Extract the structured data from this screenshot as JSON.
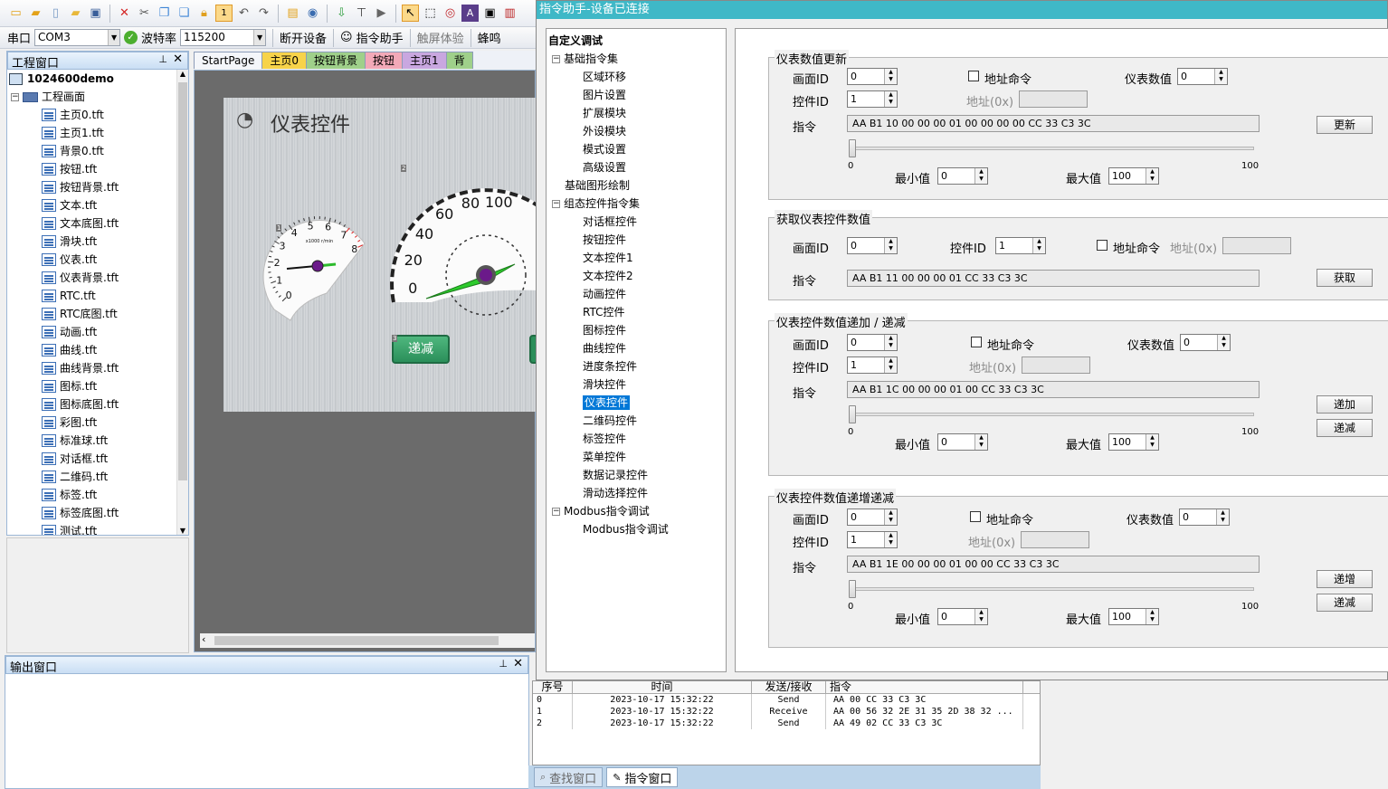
{
  "toolbar2": {
    "port_label": "串口",
    "port_value": "COM3",
    "baud_label": "波特率",
    "baud_value": "115200",
    "disconnect": "断开设备",
    "assistant": "指令助手",
    "touch": "触屏体验",
    "buzzer": "蜂鸣"
  },
  "project": {
    "title": "工程窗口",
    "root": "1024600demo",
    "folder": "工程画面",
    "files": [
      "主页0.tft",
      "主页1.tft",
      "背景0.tft",
      "按钮.tft",
      "按钮背景.tft",
      "文本.tft",
      "文本底图.tft",
      "滑块.tft",
      "仪表.tft",
      "仪表背景.tft",
      "RTC.tft",
      "RTC底图.tft",
      "动画.tft",
      "曲线.tft",
      "曲线背景.tft",
      "图标.tft",
      "图标底图.tft",
      "彩图.tft",
      "标准球.tft",
      "对话框.tft",
      "二维码.tft",
      "标签.tft",
      "标签底图.tft",
      "测试.tft"
    ]
  },
  "tabs": [
    {
      "label": "StartPage",
      "color": "#f4f6fa"
    },
    {
      "label": "主页0",
      "color": "#f7d34a"
    },
    {
      "label": "按钮背景",
      "color": "#9fd08a"
    },
    {
      "label": "按钮",
      "color": "#f3a9b8"
    },
    {
      "label": "主页1",
      "color": "#c9a7e0"
    },
    {
      "label": "背",
      "color": "#9fd08a"
    }
  ],
  "canvas": {
    "title": "仪表控件",
    "small_gauge_ticks": [
      "0",
      "1",
      "2",
      "3",
      "4",
      "5",
      "6",
      "7",
      "8"
    ],
    "small_gauge_unit": "x1000 r/min",
    "big_gauge_ticks": [
      "0",
      "20",
      "40",
      "60",
      "80",
      "100"
    ],
    "button_label": "递减",
    "marker_2": "2",
    "marker_1": "1",
    "marker_3": "3"
  },
  "output": {
    "title": "输出窗口"
  },
  "dialog": {
    "title": "指令助手-设备已连接",
    "nav": {
      "root": "自定义调试",
      "group1": "基础指令集",
      "group1_items": [
        "区域环移",
        "图片设置",
        "扩展模块",
        "外设模块",
        "模式设置",
        "高级设置"
      ],
      "basic_draw": "基础图形绘制",
      "group2": "组态控件指令集",
      "group2_items": [
        "对话框控件",
        "按钮控件",
        "文本控件1",
        "文本控件2",
        "动画控件",
        "RTC控件",
        "图标控件",
        "曲线控件",
        "进度条控件",
        "滑块控件",
        "仪表控件",
        "二维码控件",
        "标签控件",
        "菜单控件",
        "数据记录控件",
        "滑动选择控件"
      ],
      "selected": "仪表控件",
      "group3": "Modbus指令调试",
      "group3_items": [
        "Modbus指令调试"
      ]
    },
    "labels": {
      "screen_id": "画面ID",
      "control_id": "控件ID",
      "addr_cmd": "地址命令",
      "addr": "地址(0x)",
      "gauge_value": "仪表数值",
      "command": "指令",
      "min": "最小值",
      "max": "最大值",
      "tick_min": "0",
      "tick_max": "100"
    },
    "groups": [
      {
        "title": "仪表数值更新",
        "screen_id": "0",
        "control_id": "1",
        "gauge_value": "0",
        "command": "AA B1 10 00 00 00 01 00 00 00 00 CC 33 C3 3C",
        "min": "0",
        "max": "100",
        "buttons": [
          "更新"
        ]
      },
      {
        "title": "获取仪表控件数值",
        "screen_id": "0",
        "control_id": "1",
        "command": "AA B1 11 00 00 00 01 CC 33 C3 3C",
        "buttons": [
          "获取"
        ]
      },
      {
        "title": "仪表控件数值递加 / 递减",
        "screen_id": "0",
        "control_id": "1",
        "gauge_value": "0",
        "command": "AA B1 1C 00 00 00 01 00 CC 33 C3 3C",
        "min": "0",
        "max": "100",
        "buttons": [
          "递加",
          "递减"
        ]
      },
      {
        "title": "仪表控件数值递增递减",
        "screen_id": "0",
        "control_id": "1",
        "gauge_value": "0",
        "command": "AA B1 1E 00 00 00 01 00 00 CC 33 C3 3C",
        "min": "0",
        "max": "100",
        "buttons": [
          "递增",
          "递减"
        ]
      }
    ]
  },
  "cmdlog": {
    "headers": [
      "序号",
      "时间",
      "发送/接收",
      "指令"
    ],
    "rows": [
      [
        "0",
        "2023-10-17 15:32:22",
        "Send",
        "AA 00 CC 33 C3 3C"
      ],
      [
        "1",
        "2023-10-17 15:32:22",
        "Receive",
        "AA 00 56 32 2E 31 35 2D 38 32 ..."
      ],
      [
        "2",
        "2023-10-17 15:32:22",
        "Send",
        "AA 49 02 CC 33 C3 3C"
      ]
    ]
  },
  "bottom_tabs": [
    "查找窗口",
    "指令窗口"
  ]
}
